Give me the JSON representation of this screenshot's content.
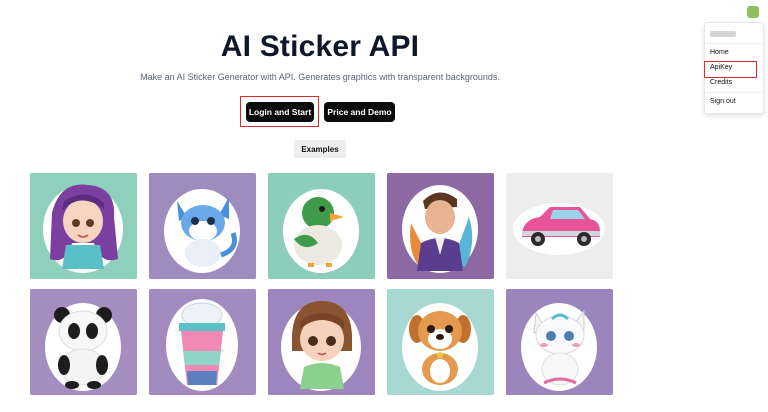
{
  "hero": {
    "title": "AI Sticker API",
    "subtitle": "Make an AI Sticker Generator with API. Generates graphics with transparent backgrounds.",
    "login_label": "Login and Start",
    "price_label": "Price and Demo",
    "examples_label": "Examples"
  },
  "user_menu": {
    "items": [
      "Home",
      "ApiKey",
      "Credits",
      "Sign out"
    ]
  },
  "examples": [
    {
      "subject": "girl-purple-hair",
      "bg": "#8fd0bd"
    },
    {
      "subject": "blue-kitten",
      "bg": "#9e8cbf"
    },
    {
      "subject": "duck",
      "bg": "#8ccdbc"
    },
    {
      "subject": "man-suit",
      "bg": "#8e6aa4"
    },
    {
      "subject": "pink-car",
      "bg": "#ededed"
    },
    {
      "subject": "panda",
      "bg": "#a48ec0"
    },
    {
      "subject": "milkshake-cup",
      "bg": "#a28cbf"
    },
    {
      "subject": "girl-brown-hair",
      "bg": "#9d86bd"
    },
    {
      "subject": "puppy",
      "bg": "#a7d8d2"
    },
    {
      "subject": "white-cat",
      "bg": "#9b85bb"
    }
  ],
  "colors": {
    "button_bg": "#0b0b0b",
    "highlight": "#d92b2b",
    "avatar": "#8fbf5a"
  }
}
